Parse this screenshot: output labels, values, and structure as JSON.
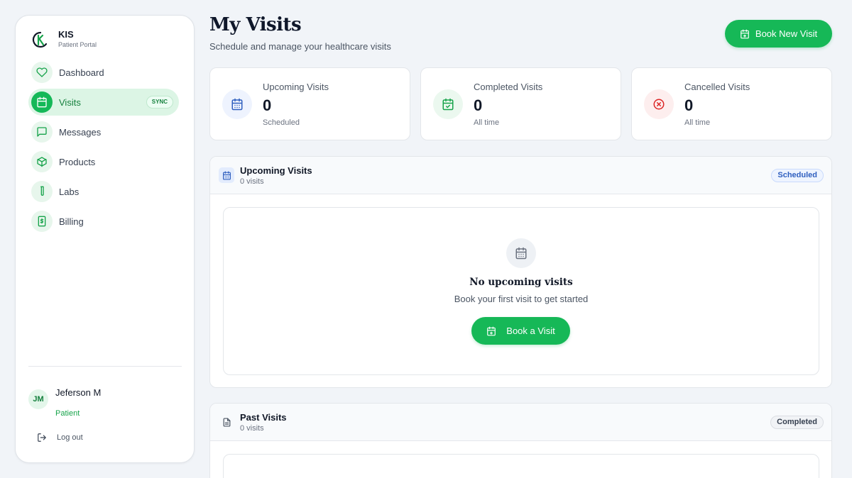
{
  "brand": {
    "name": "KIS",
    "subtitle": "Patient Portal"
  },
  "sidebar": {
    "items": [
      {
        "label": "Dashboard",
        "icon": "heart-icon"
      },
      {
        "label": "Visits",
        "icon": "calendar-icon",
        "active": true,
        "badge": "SYNC"
      },
      {
        "label": "Messages",
        "icon": "message-icon"
      },
      {
        "label": "Products",
        "icon": "box-icon"
      },
      {
        "label": "Labs",
        "icon": "test-tube-icon"
      },
      {
        "label": "Billing",
        "icon": "billing-icon"
      }
    ]
  },
  "user": {
    "initials": "JM",
    "name": "Jeferson M",
    "role": "Patient",
    "logout_label": "Log out"
  },
  "header": {
    "title": "My Visits",
    "subtitle": "Schedule and manage your healthcare visits",
    "book_new_label": "Book New Visit"
  },
  "stats": [
    {
      "label": "Upcoming Visits",
      "value": "0",
      "sub": "Scheduled",
      "icon": "calendar-icon",
      "color": "#2f5fbf"
    },
    {
      "label": "Completed Visits",
      "value": "0",
      "sub": "All time",
      "icon": "calendar-check-icon",
      "color": "#16a34a"
    },
    {
      "label": "Cancelled Visits",
      "value": "0",
      "sub": "All time",
      "icon": "x-circle-icon",
      "color": "#dc2626"
    }
  ],
  "upcoming": {
    "title": "Upcoming Visits",
    "count": "0 visits",
    "badge": "Scheduled",
    "empty_title": "No upcoming visits",
    "empty_sub": "Book your first visit to get started",
    "book_label": "Book a Visit"
  },
  "past": {
    "title": "Past Visits",
    "count": "0 visits",
    "badge": "Completed"
  },
  "colors": {
    "accent": "#16b857",
    "active_bg": "#dcf5e5"
  }
}
